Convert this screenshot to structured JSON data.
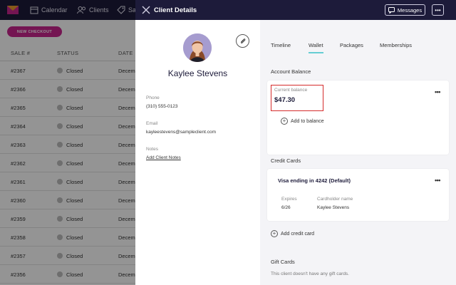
{
  "nav": {
    "calendar": "Calendar",
    "clients": "Clients",
    "sales": "Sal"
  },
  "sales_list": {
    "new_checkout": "NEW CHECKOUT",
    "headers": {
      "sale": "SALE #",
      "status": "STATUS",
      "date": "DATE"
    },
    "rows": [
      {
        "sale": "#2367",
        "status": "Closed",
        "date": "Decemb"
      },
      {
        "sale": "#2366",
        "status": "Closed",
        "date": "Decemb"
      },
      {
        "sale": "#2365",
        "status": "Closed",
        "date": "Decemb"
      },
      {
        "sale": "#2364",
        "status": "Closed",
        "date": "Decemb"
      },
      {
        "sale": "#2363",
        "status": "Closed",
        "date": "Decemb"
      },
      {
        "sale": "#2362",
        "status": "Closed",
        "date": "Decemb"
      },
      {
        "sale": "#2361",
        "status": "Closed",
        "date": "Decemb"
      },
      {
        "sale": "#2360",
        "status": "Closed",
        "date": "Decemb"
      },
      {
        "sale": "#2359",
        "status": "Closed",
        "date": "Decemb"
      },
      {
        "sale": "#2358",
        "status": "Closed",
        "date": "Decemb"
      },
      {
        "sale": "#2357",
        "status": "Closed",
        "date": "Decemb"
      },
      {
        "sale": "#2356",
        "status": "Closed",
        "date": "Decemb"
      }
    ]
  },
  "panel": {
    "title": "Client Details",
    "messages": "Messages",
    "more": "•••"
  },
  "client": {
    "name": "Kaylee Stevens",
    "phone_label": "Phone",
    "phone": "(310) 555-0123",
    "email_label": "Email",
    "email": "kayleestevens@sampleclient.com",
    "notes_label": "Notes",
    "add_notes": "Add Client Notes"
  },
  "tabs": [
    {
      "label": "Timeline"
    },
    {
      "label": "Wallet"
    },
    {
      "label": "Packages"
    },
    {
      "label": "Memberships"
    }
  ],
  "wallet": {
    "account_balance_title": "Account Balance",
    "current_balance_label": "Current balance",
    "current_balance_value": "$47.30",
    "add_to_balance": "Add to balance",
    "credit_cards_title": "Credit Cards",
    "card_title": "Visa ending in 4242 (Default)",
    "expires_label": "Expires",
    "expires_value": "6/26",
    "cardholder_label": "Cardholder name",
    "cardholder_value": "Kaylee Stevens",
    "add_credit_card": "Add credit card",
    "gift_cards_title": "Gift Cards",
    "gift_cards_empty": "This client doesn't have any gift cards."
  },
  "colors": {
    "navy": "#1d1b3a",
    "accent_pink": "#c9258e",
    "active_tab": "#66cdd3",
    "highlight_red": "#d52b2b"
  }
}
